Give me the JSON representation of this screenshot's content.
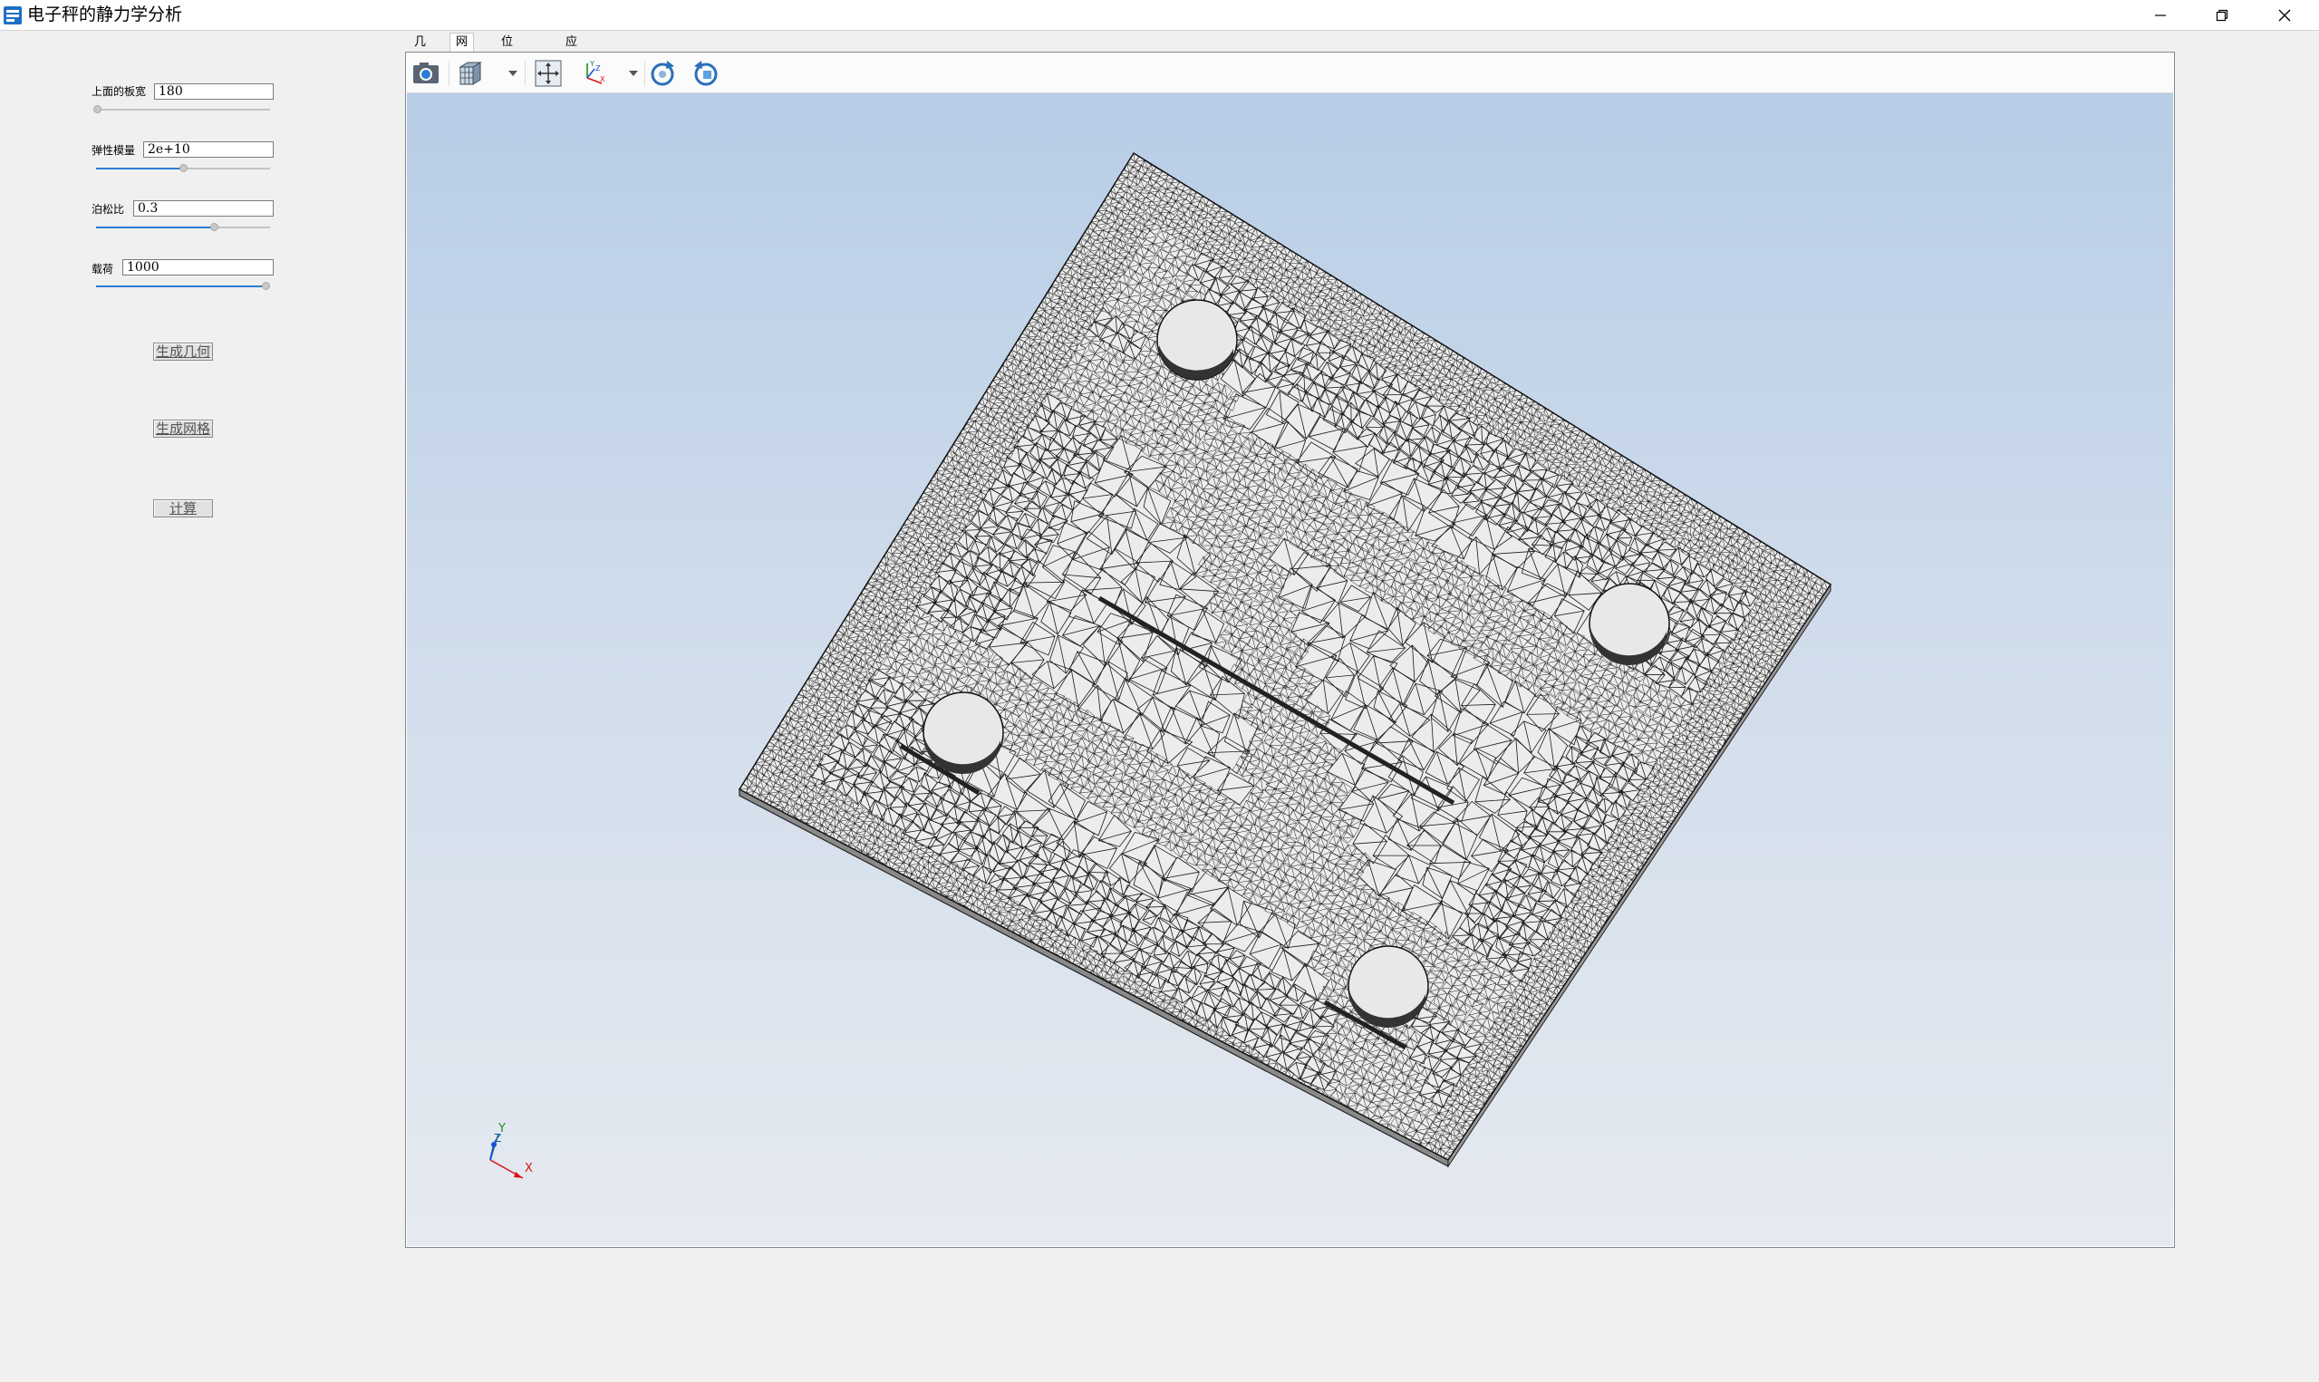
{
  "window": {
    "title": "电子秤的静力学分析"
  },
  "params": [
    {
      "label": "上面的板宽",
      "value": "180",
      "slider_fraction": 0.0
    },
    {
      "label": "弹性模量",
      "value": "2e+10",
      "slider_fraction": 0.5
    },
    {
      "label": "泊松比",
      "value": "0.3",
      "slider_fraction": 0.68
    },
    {
      "label": "载荷",
      "value": "1000",
      "slider_fraction": 1.0
    }
  ],
  "buttons": {
    "gen_geometry": "生成几何",
    "gen_mesh": "生成网格",
    "compute": "计算"
  },
  "tabs": [
    "几何",
    "网格",
    "位移云图",
    "应力云图"
  ],
  "active_tab": "网格",
  "toolbar": {
    "icons": [
      "camera-icon",
      "cube-view-icon",
      "fit-view-icon",
      "axes-icon",
      "rotate-cw-icon",
      "rotate-ccw-icon"
    ]
  },
  "triad": {
    "x": "X",
    "y": "Y",
    "z": "Z"
  },
  "colors": {
    "accent": "#2b7cd3",
    "mesh_line": "#1a1a1a",
    "plate": "#ececec"
  }
}
